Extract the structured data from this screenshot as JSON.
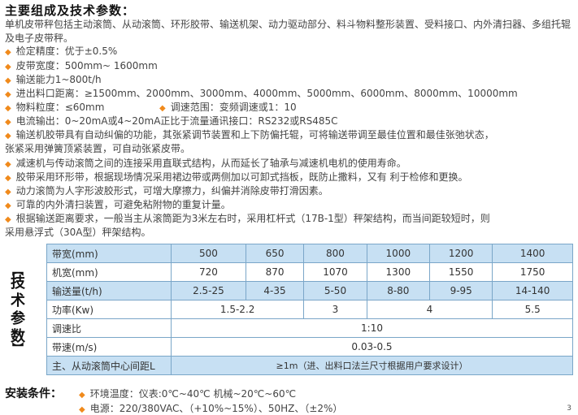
{
  "title": "主要组成及技术参数：",
  "intro": "单机皮带秤包括主动滚筒、从动滚筒、环形胶带、输送机架、动力驱动部分、料斗物料整形装置、受料接口、内外清扫器、多组托辊及电子皮带秤。",
  "bullets": [
    "检定精度：优于±0.5%",
    "皮带宽度：500mm~ 1600mm",
    "输送能力1~800t/h",
    "进出料口距离：≥1500mm、2000mm、3000mm、4000mm、5000mm、6000mm、8000mm、10000mm",
    "物料粒度：≤60mm",
    "电流输出：0~20mA或4~20mA正比于流量通讯接口：RS232或RS485C",
    "输送机胶带具有自动纠偏的功能，其张紧调节装置和上下防偏托辊，可将输送带调至最佳位置和最佳张弛状态，",
    "减速机与传动滚筒之间的连接采用直联式结构，从而延长了轴承与减速机电机的使用寿命。",
    "胶带采用环形带，根据现场情况采用裙边带或两侧加以可卸式挡板，既防止撒料，又有 利于检修和更换。",
    "动力滚筒为人字形波胶形式，可增大摩擦力，纠偏并消除皮带打滑因素。",
    "可靠的内外清扫装置，可避免粘附物的重复计量。",
    "根据输送距离要求，一般当主从滚筒距为3米左右时，采用杠杆式（17B-1型）秤架结构，而当间距较短时，则"
  ],
  "bullet_speed": "调速范围：变频调速或1：10",
  "bullet7_cont": "张紧采用弹簧顶紧装置，可自动张紧皮带。",
  "bullet12_cont": "采用悬浮式（30A型）秤架结构。",
  "side_label": [
    "技",
    "术",
    "参",
    "数"
  ],
  "table": {
    "rows": [
      {
        "label": "带宽(mm)",
        "cells": [
          "500",
          "650",
          "800",
          "1000",
          "1200",
          "1400"
        ]
      },
      {
        "label": "机宽(mm)",
        "cells": [
          "720",
          "870",
          "1070",
          "1300",
          "1550",
          "1750"
        ]
      },
      {
        "label": "输送量(t/h)",
        "cells": [
          "2.5-25",
          "4-35",
          "5-50",
          "8-80",
          "9-95",
          "14-140"
        ]
      },
      {
        "label": "功率(Kw)",
        "cells": [
          "1.5-2.2",
          "3",
          "4",
          "5.5"
        ]
      },
      {
        "label": "调速比",
        "cells": [
          "1:10"
        ]
      },
      {
        "label": "带速(m/s)",
        "cells": [
          "0.03-0.5"
        ]
      },
      {
        "label": "主、从动滚筒中心间距L",
        "cells": [
          "≥1m（进、出料口法兰尺寸根据用户要求设计）"
        ]
      }
    ]
  },
  "install_title": "安装条件：",
  "install": [
    "环境温度：仪表:0℃~40℃   机械~20℃~60℃",
    "电源：220/380VAC、（+10%~15%）、50HZ、（±2%）"
  ],
  "page_number": "3",
  "colors": {
    "accent": "#f08a1c",
    "table_blue": "#c7e0f3",
    "table_border": "#7aa6c8"
  }
}
